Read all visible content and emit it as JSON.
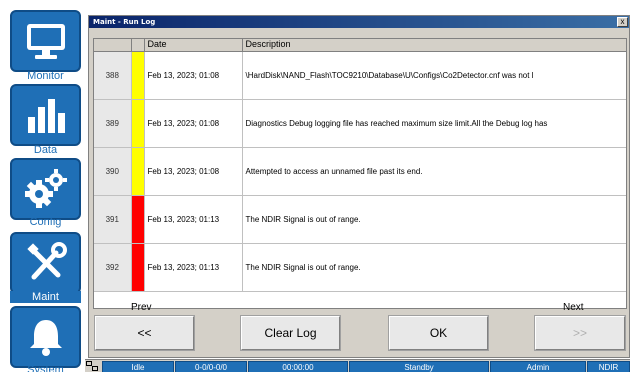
{
  "sidebar": {
    "items": [
      {
        "label": "Monitor"
      },
      {
        "label": "Data"
      },
      {
        "label": "Config"
      },
      {
        "label": "Maint"
      },
      {
        "label": "System"
      }
    ]
  },
  "dialog": {
    "title": "Maint - Run Log",
    "close_label": "x"
  },
  "table": {
    "headers": [
      "",
      "",
      "Date",
      "Description"
    ],
    "rows": [
      {
        "num": "388",
        "severity": "#ffff00",
        "date": "Feb 13, 2023; 01:08",
        "description": "\\HardDisk\\NAND_Flash\\TOC9210\\Database\\U\\Configs\\Co2Detector.cnf was not l"
      },
      {
        "num": "389",
        "severity": "#ffff00",
        "date": "Feb 13, 2023; 01:08",
        "description": "Diagnostics Debug logging file has reached maximum size limit.All the Debug log has"
      },
      {
        "num": "390",
        "severity": "#ffff00",
        "date": "Feb 13, 2023; 01:08",
        "description": "Attempted to access an unnamed file past its end."
      },
      {
        "num": "391",
        "severity": "#ff0000",
        "date": "Feb 13, 2023; 01:13",
        "description": "The NDIR Signal is out of range."
      },
      {
        "num": "392",
        "severity": "#ff0000",
        "date": "Feb 13, 2023; 01:13",
        "description": "The NDIR Signal is out of range."
      }
    ]
  },
  "nav": {
    "prev_label": "Prev",
    "next_label": "Next",
    "prev_button": "<<",
    "clear_button": "Clear Log",
    "ok_button": "OK",
    "next_button": ">>"
  },
  "statusbar": {
    "cells": [
      "Idle",
      "0-0/0-0/0",
      "00:00:00",
      "Standby",
      "Admin",
      "NDIR"
    ]
  },
  "colors": {
    "accent": "#1f6fb6",
    "warning": "#ffff00",
    "error": "#ff0000"
  }
}
